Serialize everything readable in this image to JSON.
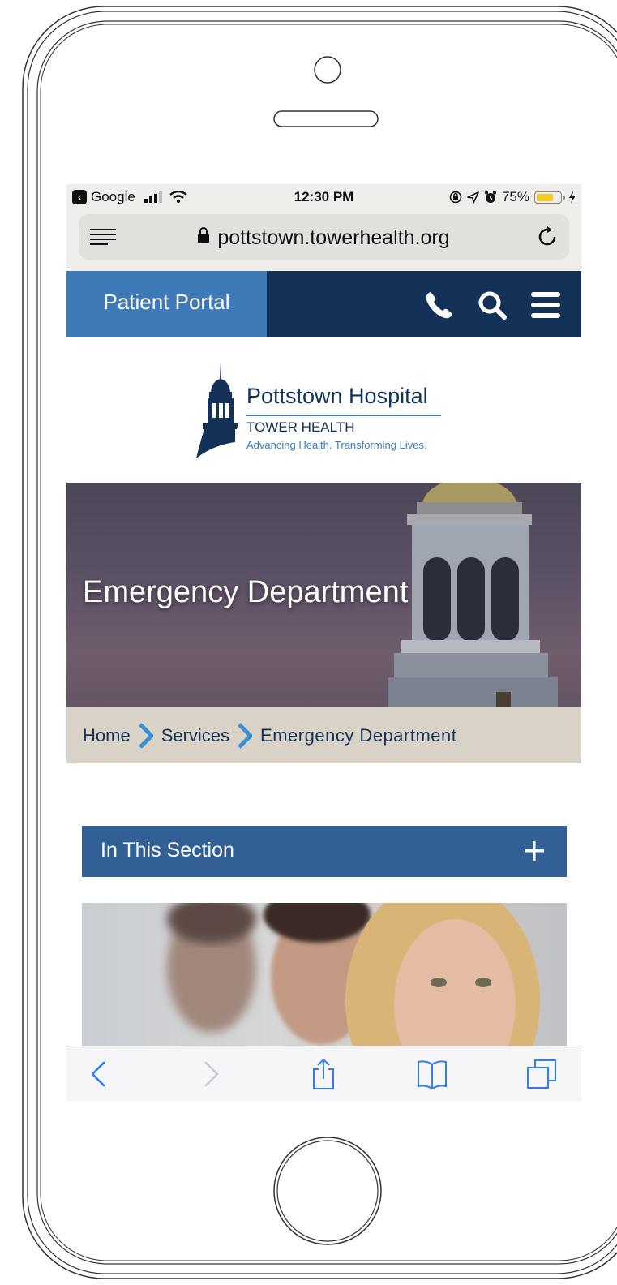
{
  "status_bar": {
    "back_app": "Google",
    "time": "12:30 PM",
    "battery_percent": "75%",
    "battery_level": 0.75,
    "icons": [
      "cellular-signal-icon",
      "wifi-icon",
      "orientation-lock-icon",
      "location-icon",
      "alarm-icon",
      "battery-icon",
      "charging-icon"
    ]
  },
  "browser": {
    "url": "pottstown.towerhealth.org",
    "icons": [
      "reader-icon",
      "lock-icon",
      "reload-icon"
    ]
  },
  "site_header": {
    "portal_label": "Patient Portal",
    "icons": [
      "phone-icon",
      "search-icon",
      "menu-icon"
    ],
    "colors": {
      "navy": "#143157",
      "portal_blue": "#3d7ab7"
    }
  },
  "logo": {
    "title": "Pottstown Hospital",
    "subtitle": "TOWER HEALTH",
    "tagline": "Advancing Health. Transforming Lives."
  },
  "hero": {
    "title": "Emergency Department"
  },
  "breadcrumb": {
    "items": [
      "Home",
      "Services",
      "Emergency Department"
    ]
  },
  "section": {
    "label": "In This Section",
    "icon": "plus-icon"
  },
  "toolbar": {
    "icons": [
      "back-icon",
      "forward-icon",
      "share-icon",
      "bookmarks-icon",
      "tabs-icon"
    ]
  }
}
